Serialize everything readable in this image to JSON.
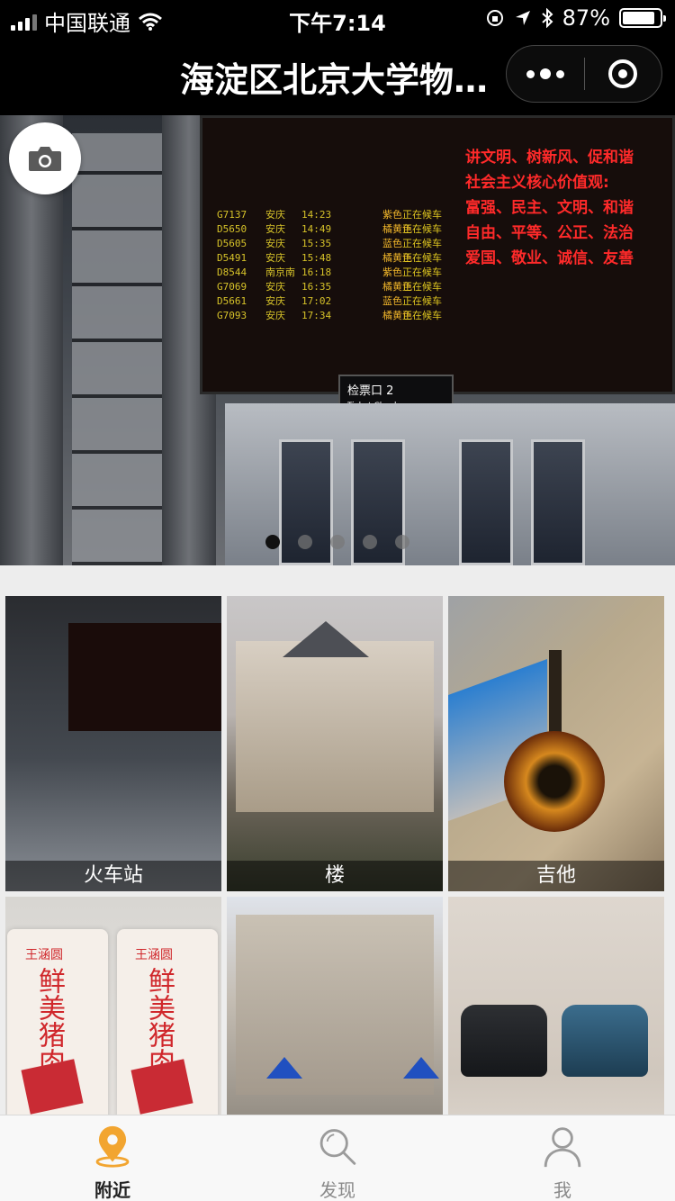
{
  "status_bar": {
    "carrier": "中国联通",
    "time": "下午7:14",
    "battery": "87%",
    "battery_level": 0.87
  },
  "nav": {
    "title": "海淀区北京大学物…"
  },
  "banner": {
    "slide_count": 5,
    "active_slide": 1
  },
  "photos": [
    {
      "label": "火车站"
    },
    {
      "label": "楼"
    },
    {
      "label": "吉他"
    },
    {
      "label": ""
    },
    {
      "label": ""
    },
    {
      "label": ""
    }
  ],
  "tabs": [
    {
      "label": "附近",
      "icon": "location-pin-icon",
      "active": true
    },
    {
      "label": "发现",
      "icon": "search-icon",
      "active": false
    },
    {
      "label": "我",
      "icon": "person-icon",
      "active": false
    }
  ],
  "colors": {
    "accent": "#f2a530",
    "inactive": "#9b9b9b"
  }
}
